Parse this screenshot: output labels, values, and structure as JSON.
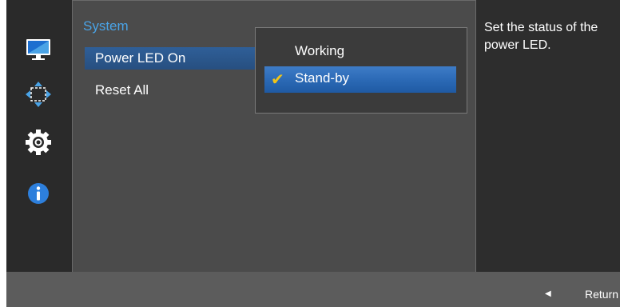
{
  "sidebar": {
    "icons": [
      "display-icon",
      "resize-arrows-icon",
      "gear-icon",
      "info-icon"
    ]
  },
  "main": {
    "title": "System",
    "items": [
      {
        "label": "Power LED On"
      },
      {
        "label": "Reset All"
      }
    ]
  },
  "dropdown": {
    "options": [
      {
        "label": "Working"
      },
      {
        "label": "Stand-by"
      }
    ],
    "selected": "Stand-by"
  },
  "help": {
    "text": "Set the status of the power LED."
  },
  "footer": {
    "return_label": "Return"
  },
  "colors": {
    "accent": "#4aa3e6",
    "selection": "#2f5f98",
    "check": "#f0c419"
  }
}
